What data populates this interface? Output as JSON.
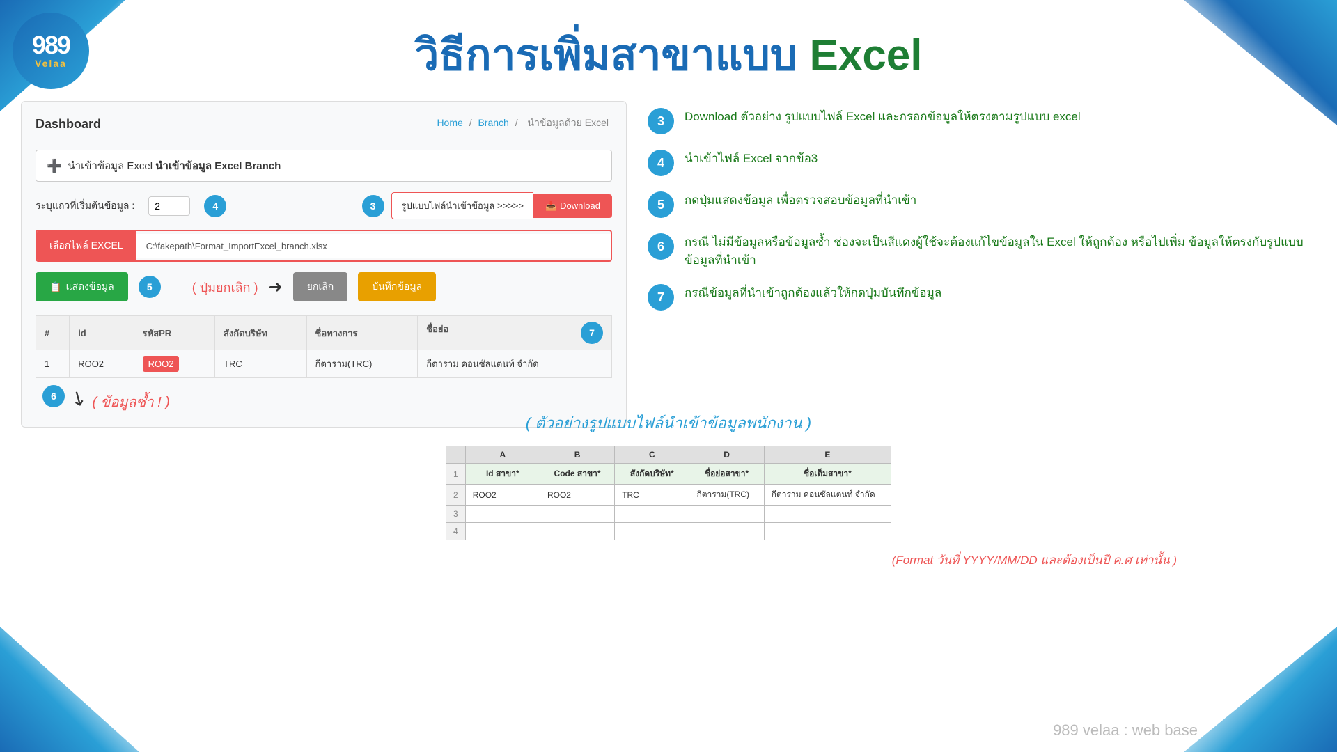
{
  "logo": {
    "number": "989",
    "brand": "Velaa"
  },
  "page_title": {
    "part1": "วิธีการเพิ่มสาขาแบบ ",
    "part2": "Excel"
  },
  "breadcrumb": {
    "home": "Home",
    "separator1": "/",
    "branch": "Branch",
    "separator2": "/",
    "current": "นำข้อมูลด้วย Excel"
  },
  "dashboard": {
    "title": "Dashboard",
    "import_label": "นำเข้าข้อมูล Excel Branch",
    "start_row_label": "ระบุแถวที่เริ่มต้นข้อมูล :",
    "start_row_value": "2",
    "badge4": "4",
    "badge3_left": "3",
    "download_label": "รูปแบบไฟล์นำเข้าข้อมูล >>>>>",
    "download_btn": "Download",
    "file_btn": "เลือกไฟล์ EXCEL",
    "file_path": "C:\\fakepath\\Format_ImportExcel_branch.xlsx",
    "show_data_btn": "แสดงข้อมูล",
    "badge5": "5",
    "cancel_annotation": "( ปุ่มยกเลิก )",
    "cancel_btn": "ยกเลิก",
    "save_btn": "บันทึกข้อมูล",
    "table": {
      "headers": [
        "#",
        "id",
        "รหัสPR",
        "สังกัดบริษัท",
        "ชื่อทางการ",
        "ชื่อย่อ"
      ],
      "rows": [
        [
          "1",
          "ROO2",
          "ROO2",
          "TRC",
          "กีตาราม(TRC)",
          "กีตาราม คอนซัลแตนท์ จำกัด"
        ]
      ]
    },
    "badge7": "7",
    "badge6": "6",
    "duplicate_label": "( ข้อมูลซ้ำ ! )"
  },
  "instructions": [
    {
      "step": "3",
      "text": "Download ตัวอย่าง รูปแบบไฟล์ Excel และกรอกข้อมูลให้ตรงตามรูปแบบ excel"
    },
    {
      "step": "4",
      "text": "นำเข้าไฟล์ Excel จากข้อ3"
    },
    {
      "step": "5",
      "text": "กดปุ่มแสดงข้อมูล เพื่อตรวจสอบข้อมูลที่นำเข้า"
    },
    {
      "step": "6",
      "text": "กรณี ไม่มีข้อมูลหรือข้อมูลซ้ำ ช่องจะเป็นสีแดงผู้ใช้จะต้องแก้ไขข้อมูลใน Excel ให้ถูกต้อง หรือไปเพิ่ม ข้อมูลให้ตรงกับรูปแบบข้อมูลที่นำเข้า"
    },
    {
      "step": "7",
      "text": "กรณีข้อมูลที่นำเข้าถูกต้องแล้วให้กดปุ่มบันทึกข้อมูล"
    }
  ],
  "bottom": {
    "example_label": "( ตัวอย่างรูปแบบไฟล์นำเข้าข้อมูลพนักงาน )",
    "excel_headers": [
      "",
      "A",
      "B",
      "C",
      "D",
      "E"
    ],
    "excel_col_labels": [
      "Id สาขา*",
      "Code สาขา*",
      "สังกัดบริษัท*",
      "ชื่อย่อสาขา*",
      "ชื่อเต็มสาขา*"
    ],
    "excel_row1_label": "1",
    "excel_row2_label": "2",
    "excel_row2_data": [
      "ROO2",
      "ROO2",
      "TRC",
      "กีตาราม(TRC)",
      "กีตาราม คอนซัลแตนท์ จำกัด"
    ],
    "excel_row3_label": "3",
    "excel_row4_label": "4",
    "format_note": "(Format วันที่ YYYY/MM/DD  และต้องเป็นปี ค.ศ เท่านั้น )",
    "footer_brand": "989 velaa : web base"
  }
}
